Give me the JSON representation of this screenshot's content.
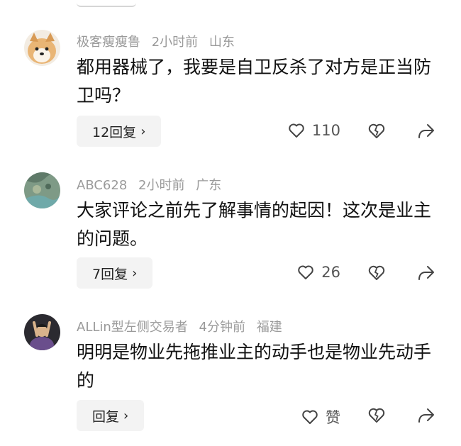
{
  "comments": [
    {
      "username": "极客瘦瘦鲁",
      "time": "2小时前",
      "location": "山东",
      "text": "都用器械了，我要是自卫反杀了对方是正当防卫吗？",
      "reply_label": "12回复",
      "likes": "110"
    },
    {
      "username": "ABC628",
      "time": "2小时前",
      "location": "广东",
      "text": "大家评论之前先了解事情的起因！这次是业主的问题。",
      "reply_label": "7回复",
      "likes": "26"
    },
    {
      "username": "ALLin型左侧交易者",
      "time": "4分钟前",
      "location": "福建",
      "text": "明明是物业先拖推业主的动手也是物业先动手的",
      "reply_label": "回复",
      "likes": "赞"
    }
  ],
  "icons": {
    "like": "heart-outline-icon",
    "dislike": "broken-heart-icon",
    "share": "share-arrow-icon",
    "chevron": "chevron-right-icon"
  }
}
